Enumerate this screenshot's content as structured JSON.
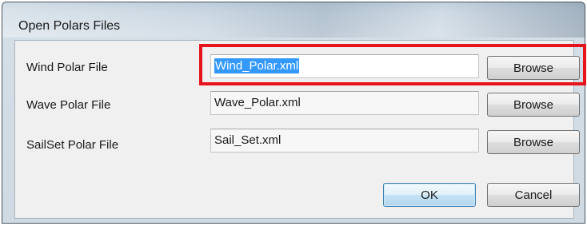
{
  "window": {
    "title": "Open Polars Files"
  },
  "rows": [
    {
      "label": "Wind Polar File",
      "value": "Wind_Polar.xml",
      "browse_label": "Browse"
    },
    {
      "label": "Wave Polar File",
      "value": "Wave_Polar.xml",
      "browse_label": "Browse"
    },
    {
      "label": "SailSet Polar File",
      "value": "Sail_Set.xml",
      "browse_label": "Browse"
    }
  ],
  "actions": {
    "ok_label": "OK",
    "cancel_label": "Cancel"
  },
  "colors": {
    "highlight": "#e8141c",
    "selection": "#3399ff"
  }
}
